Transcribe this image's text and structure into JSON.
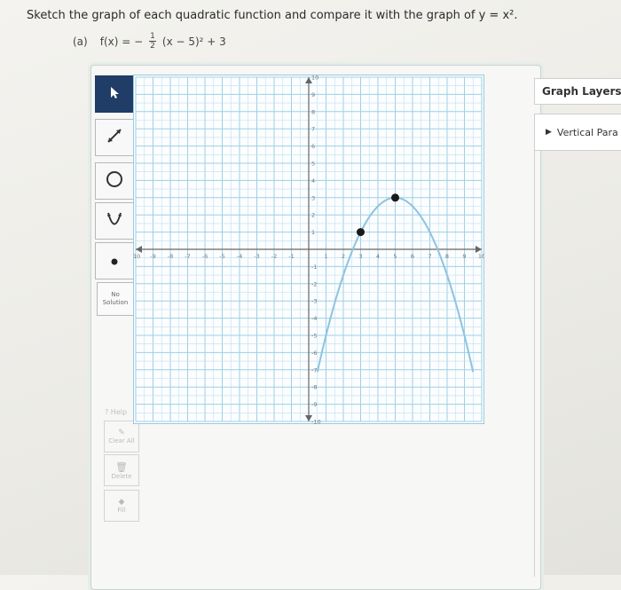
{
  "prompt": {
    "text": "Sketch the graph of each quadratic function and compare it with the graph of y = x²."
  },
  "part": {
    "label": "(a)",
    "func_left": "f(x) = −",
    "frac_num": "1",
    "frac_den": "2",
    "func_right": "(x − 5)² + 3"
  },
  "tools": {
    "no_solution_line1": "No",
    "no_solution_line2": "Solution",
    "help": "Help",
    "clear_all": "Clear All",
    "delete": "Delete",
    "fill": "Fill"
  },
  "graph_layers": {
    "title": "Graph Layers",
    "item": "Vertical Para"
  },
  "colors": {
    "curve": "#8cc4e0",
    "point": "#1a1a1a",
    "grid_minor": "#bfe0ef",
    "grid_major": "#9fcfe6",
    "selected_tool": "#1f3d66"
  },
  "chart_data": {
    "type": "line",
    "xlim": [
      -10,
      10
    ],
    "ylim": [
      -10,
      10
    ],
    "grid": true,
    "x_ticks": [
      -10,
      -9,
      -8,
      -7,
      -6,
      -5,
      -4,
      -3,
      -2,
      -1,
      1,
      2,
      3,
      4,
      5,
      6,
      7,
      8,
      9,
      10
    ],
    "y_ticks": [
      -10,
      -9,
      -8,
      -7,
      -6,
      -5,
      -4,
      -3,
      -2,
      -1,
      1,
      2,
      3,
      4,
      5,
      6,
      7,
      8,
      9,
      10
    ],
    "curve": {
      "equation": "f(x) = -1/2 (x-5)^2 + 3",
      "a": -0.5,
      "h": 5,
      "k": 3,
      "x_range": [
        0.5,
        9.5
      ]
    },
    "points": [
      {
        "x": 5,
        "y": 3
      },
      {
        "x": 3,
        "y": 1
      }
    ]
  }
}
